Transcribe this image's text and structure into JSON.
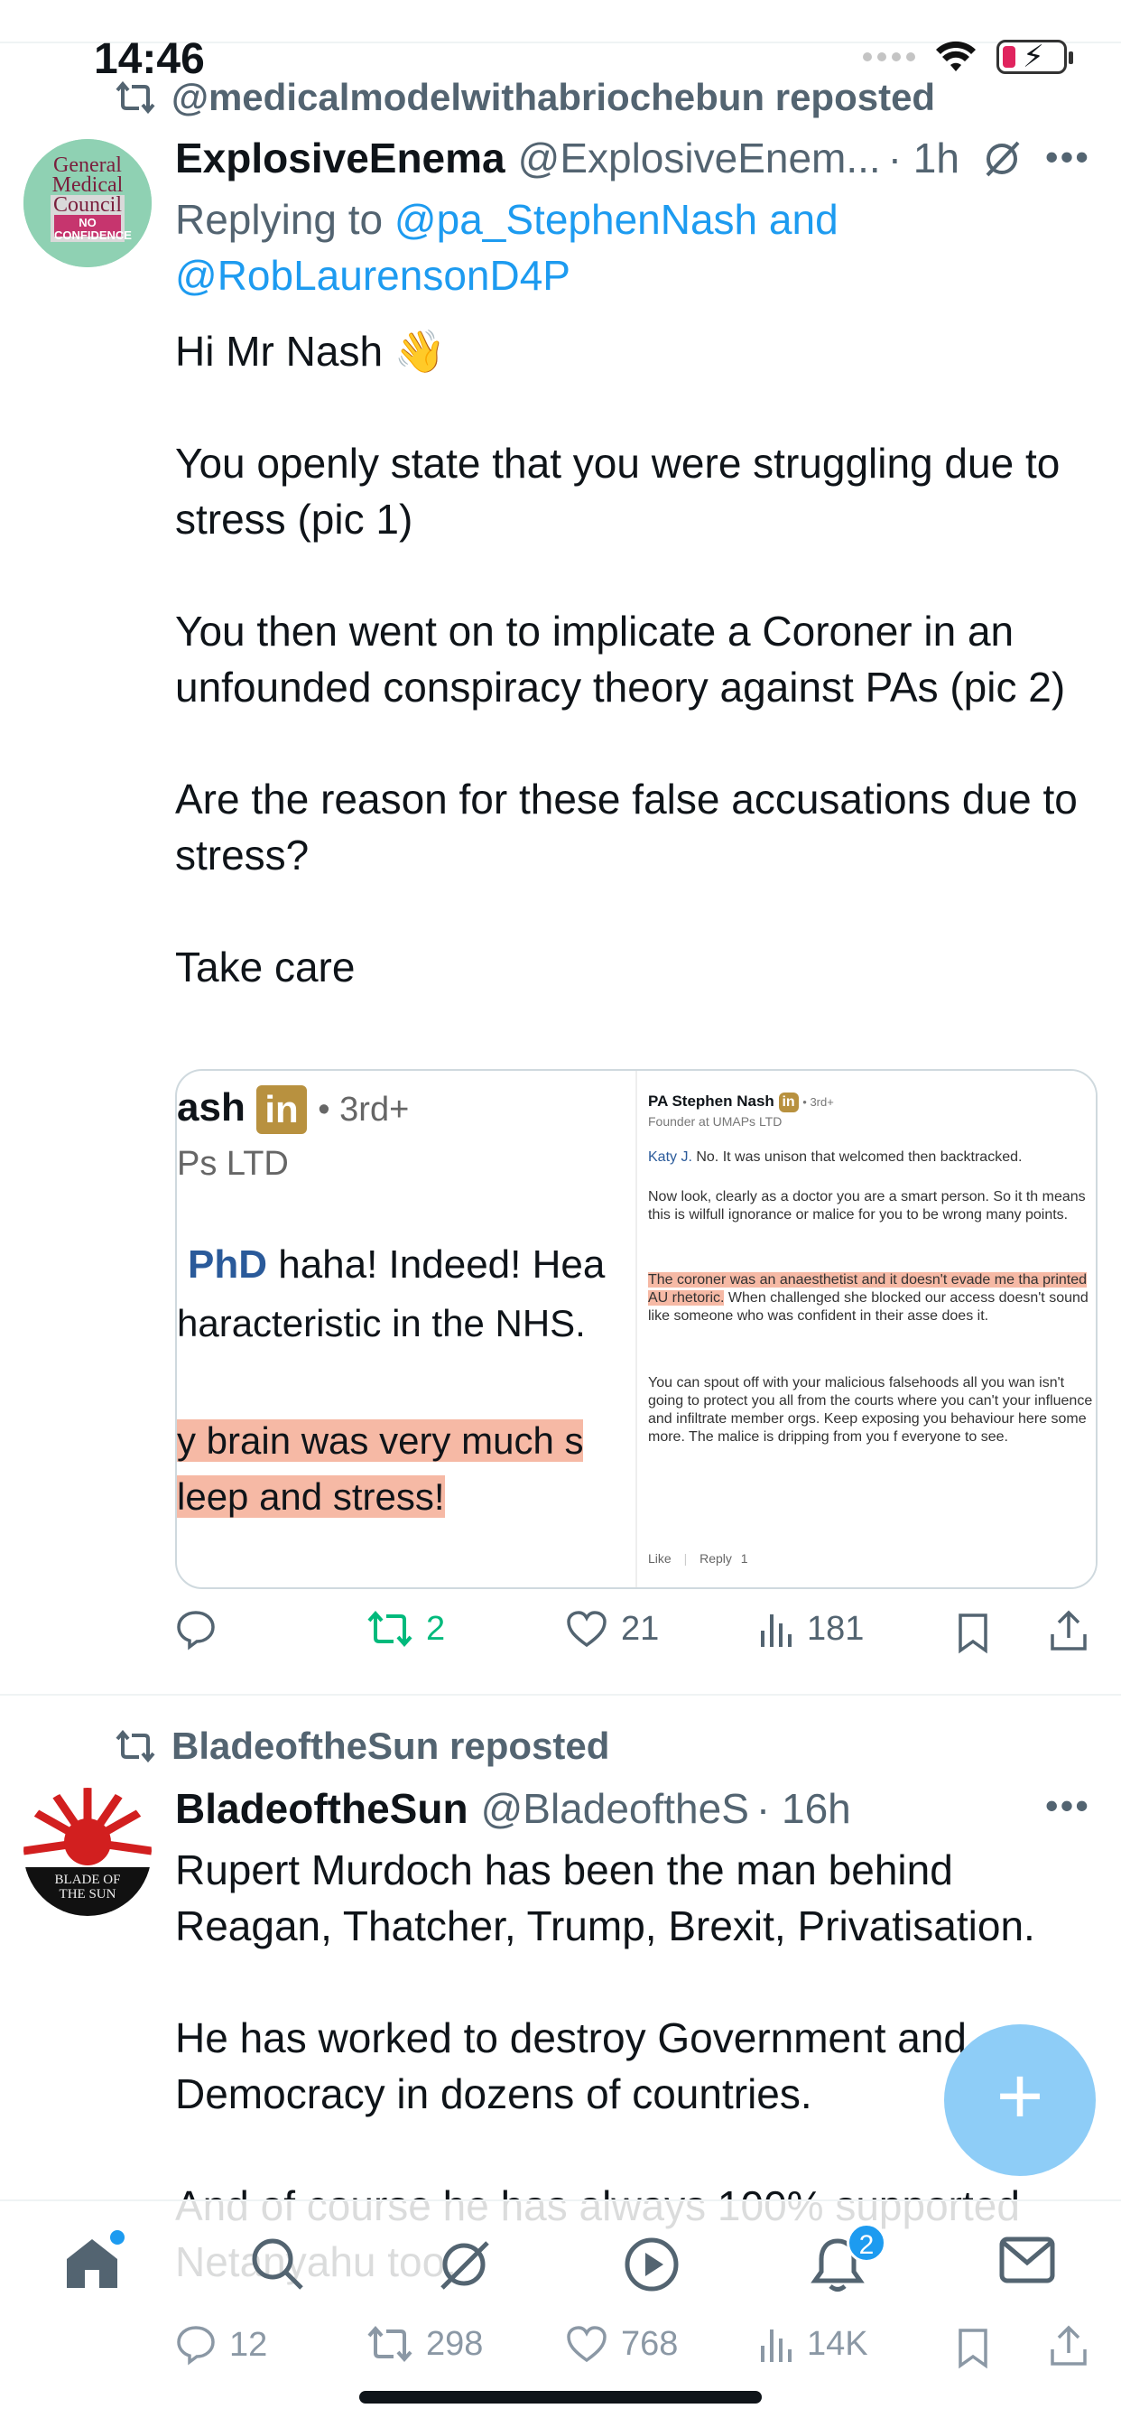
{
  "status_bar": {
    "time": "14:46"
  },
  "tweet1": {
    "repost_label": "@medicalmodelwithabriochebun reposted",
    "avatar_text": "General Medical Council",
    "avatar_stamp": "NO CONFIDENCE",
    "display_name": "ExplosiveEnema",
    "handle": "@ExplosiveEnem...",
    "time": "· 1h",
    "reply_prefix": "Replying to ",
    "reply_user1": "@pa_StephenNash",
    "reply_and": " and",
    "reply_user2": "@RobLaurensonD4P",
    "paragraphs": [
      "Hi Mr Nash 👋",
      "You openly state that you were struggling due to stress (pic 1)",
      "You then went on to implicate a Coroner in an unfounded conspiracy theory against PAs (pic 2)",
      "Are the reason for these false accusations due to stress?",
      "Take care"
    ],
    "media_left": {
      "name_fragment": "ash",
      "degree": "• 3rd+",
      "company_fragment": "Ps LTD",
      "line1_bold": "PhD",
      "line1_rest": " haha! Indeed! Hea",
      "line2": "haracteristic in the NHS.",
      "hl_line1": "y brain was very much s",
      "hl_line2": "leep and stress!"
    },
    "media_right": {
      "name": "PA Stephen Nash",
      "degree": "• 3rd+",
      "title": "Founder at UMAPs LTD",
      "mention": "Katy J.",
      "p1_rest": " No. It was unison that welcomed then backtracked.",
      "p2": "Now look, clearly as a doctor you are a smart person. So it th means this is wilfull ignorance or malice for you to be wrong many points.",
      "p3_hl": "The coroner was an anaesthetist and it doesn't evade me tha printed AU rhetoric.",
      "p3_rest": " When challenged she blocked our access doesn't sound like someone who was confident in their asse does it.",
      "p4": "You can spout off with your malicious falsehoods all you wan isn't going to protect you all from the courts where you can't your influence and infiltrate member orgs. Keep exposing you behaviour here some more. The malice is dripping from you f everyone to see.",
      "like": "Like",
      "reply": "Reply",
      "reply_count": "1"
    },
    "stats": {
      "replies": "",
      "reposts": "2",
      "likes": "21",
      "views": "181"
    }
  },
  "tweet2": {
    "repost_label": "BladeoftheSun reposted",
    "avatar_text": "BLADE OF THE SUN",
    "display_name": "BladeoftheSun",
    "handle": "@BladeoftheS",
    "time": "· 16h",
    "paragraphs": [
      "Rupert Murdoch has been the man behind Reagan, Thatcher, Trump, Brexit, Privatisation.",
      "He has worked to destroy Government and Democracy in dozens of countries.",
      "And of course he has always 100% supported Netanyahu too."
    ],
    "stats": {
      "replies": "12",
      "reposts": "298",
      "likes": "768",
      "views": "14K"
    }
  },
  "nav": {
    "notification_count": "2"
  },
  "colors": {
    "accent": "#1d9bf0",
    "repost_green": "#00ba7c",
    "fab": "#8ecdf7",
    "badge_gold": "#b8913f",
    "highlight": "#f6b9a5"
  }
}
